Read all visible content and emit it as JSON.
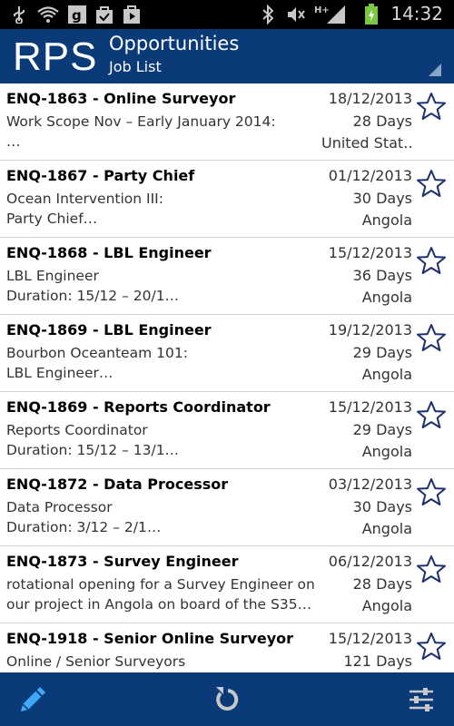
{
  "status_bar": {
    "time": "14:32",
    "icons": [
      "usb-icon",
      "wifi-icon",
      "gallery-icon",
      "bag-icon",
      "play-store-icon",
      "bluetooth-icon",
      "mute-icon",
      "signal-icon",
      "battery-charging-icon"
    ],
    "network_type": "H+"
  },
  "header": {
    "logo": "RPS",
    "title": "Opportunities",
    "subtitle": "Job List"
  },
  "jobs": [
    {
      "title": "ENQ-1863 - Online Surveyor",
      "line1": "Work Scope Nov – Early January 2014:",
      "line2": "…",
      "date": "18/12/2013",
      "days": "28 Days",
      "location": "United Stat…"
    },
    {
      "title": "ENQ-1867 - Party Chief",
      "line1": "Ocean Intervention III:",
      "line2": "Party Chief…",
      "date": "01/12/2013",
      "days": "30 Days",
      "location": "Angola"
    },
    {
      "title": "ENQ-1868 - LBL Engineer",
      "line1": "LBL Engineer",
      "line2": "Duration: 15/12 – 20/1…",
      "date": "15/12/2013",
      "days": "36 Days",
      "location": "Angola"
    },
    {
      "title": "ENQ-1869 - LBL Engineer",
      "line1": "Bourbon Oceanteam 101:",
      "line2": "LBL Engineer…",
      "date": "19/12/2013",
      "days": "29 Days",
      "location": "Angola"
    },
    {
      "title": "ENQ-1869 - Reports Coordinator",
      "line1": "Reports Coordinator",
      "line2": "Duration: 15/12 – 13/1…",
      "date": "15/12/2013",
      "days": "29 Days",
      "location": "Angola"
    },
    {
      "title": "ENQ-1872 - Data Processor",
      "line1": "Data Processor",
      "line2": "Duration: 3/12 – 2/1…",
      "date": "03/12/2013",
      "days": "30 Days",
      "location": "Angola"
    },
    {
      "title": "ENQ-1873 - Survey Engineer",
      "line1": "rotational opening for a Survey Engineer on",
      "line2": "our project in Angola on board of the S35…",
      "date": "06/12/2013",
      "days": "28 Days",
      "location": "Angola"
    },
    {
      "title": "ENQ-1918 - Senior Online Surveyor",
      "line1": "Online / Senior Surveyors",
      "line2": "",
      "date": "15/12/2013",
      "days": "121 Days",
      "location": ""
    }
  ],
  "bottom_bar": {
    "left_icon": "pencil-icon",
    "center_icon": "refresh-icon",
    "right_icon": "sliders-icon"
  },
  "colors": {
    "brand_blue": "#0a3a78",
    "star_outline": "#1c2f6e",
    "accent_light_blue": "#3fa9f5"
  }
}
